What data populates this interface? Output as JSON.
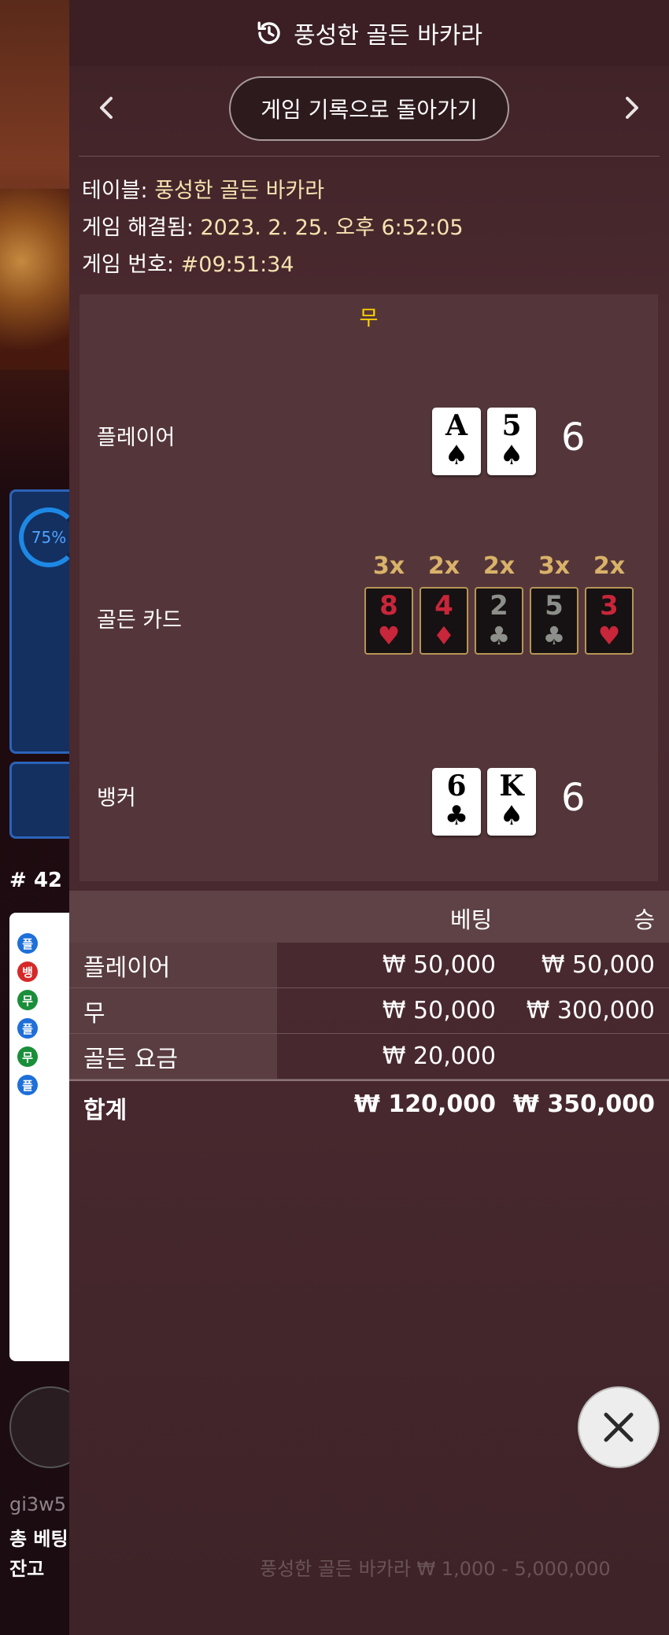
{
  "background": {
    "gauge_percent": "75%",
    "round_number": "# 42",
    "road_cells": [
      {
        "label": "플",
        "color": "#1e6fd9"
      },
      {
        "label": "뱅",
        "color": "#d62828"
      },
      {
        "label": "무",
        "color": "#1a8f3a"
      },
      {
        "label": "플",
        "color": "#1e6fd9"
      },
      {
        "label": "무",
        "color": "#1a8f3a"
      },
      {
        "label": "플",
        "color": "#1e6fd9"
      }
    ],
    "user_line": "gi3w5",
    "total_bet": "총 베팅",
    "balance": "잔고",
    "table_info": "풍성한 골든 바카라 ₩ 1,000 - 5,000,000"
  },
  "header": {
    "icon": "history-icon",
    "title": "풍성한 골든 바카라"
  },
  "nav": {
    "back_label": "게임 기록으로 돌아가기",
    "prev_icon": "chevron-left-icon",
    "next_icon": "chevron-right-icon"
  },
  "info": {
    "table_label": "테이블:",
    "table_value": "풍성한 골든 바카라",
    "resolved_label": "게임 해결됨:",
    "resolved_value": "2023. 2. 25. 오후 6:52:05",
    "game_no_label": "게임 번호:",
    "game_no_value": "#09:51:34"
  },
  "result": {
    "winner": "무",
    "player_label": "플레이어",
    "player_cards": [
      {
        "rank": "A",
        "suit": "♠",
        "color": "#000000"
      },
      {
        "rank": "5",
        "suit": "♠",
        "color": "#000000"
      }
    ],
    "player_total": "6",
    "golden_label": "골든 카드",
    "golden_cards": [
      {
        "mult": "3x",
        "rank": "8",
        "suit": "♥",
        "color": "#c8263a"
      },
      {
        "mult": "2x",
        "rank": "4",
        "suit": "♦",
        "color": "#c8263a"
      },
      {
        "mult": "2x",
        "rank": "2",
        "suit": "♣",
        "color": "#8c8f8a"
      },
      {
        "mult": "3x",
        "rank": "5",
        "suit": "♣",
        "color": "#8c8f8a"
      },
      {
        "mult": "2x",
        "rank": "3",
        "suit": "♥",
        "color": "#c8263a"
      }
    ],
    "banker_label": "뱅커",
    "banker_cards": [
      {
        "rank": "6",
        "suit": "♣",
        "color": "#000000"
      },
      {
        "rank": "K",
        "suit": "♠",
        "color": "#000000"
      }
    ],
    "banker_total": "6"
  },
  "bets": {
    "col_bet": "베팅",
    "col_win": "승",
    "rows": [
      {
        "name": "플레이어",
        "bet": "₩ 50,000",
        "win": "₩ 50,000"
      },
      {
        "name": "무",
        "bet": "₩ 50,000",
        "win": "₩ 300,000"
      },
      {
        "name": "골든 요금",
        "bet": "₩ 20,000",
        "win": ""
      }
    ],
    "total": {
      "name": "합계",
      "bet": "₩ 120,000",
      "win": "₩ 350,000"
    }
  },
  "close_icon": "close-icon"
}
